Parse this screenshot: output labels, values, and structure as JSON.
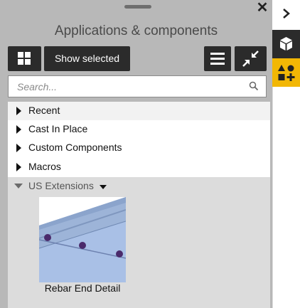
{
  "panel": {
    "title": "Applications & components",
    "show_selected_label": "Show selected",
    "search_placeholder": "Search..."
  },
  "tree": {
    "items": [
      {
        "label": "Recent"
      },
      {
        "label": "Cast In Place"
      },
      {
        "label": "Custom Components"
      },
      {
        "label": "Macros"
      }
    ],
    "expanded_group": {
      "label": "US Extensions",
      "components": [
        {
          "name": "Rebar End Detail"
        }
      ]
    }
  },
  "icons": {
    "close": "close-icon",
    "grid": "grid-view-icon",
    "list": "list-view-icon",
    "collapse": "collapse-arrows-icon",
    "search": "search-icon",
    "chevron": "chevron-right-icon",
    "cube": "cube-icon",
    "shapes": "shapes-icon"
  },
  "colors": {
    "panel_bg": "#b8b8b8",
    "button_bg": "#2b2b2b",
    "accent": "#f2b705",
    "group_bg": "#dcdcdc"
  }
}
